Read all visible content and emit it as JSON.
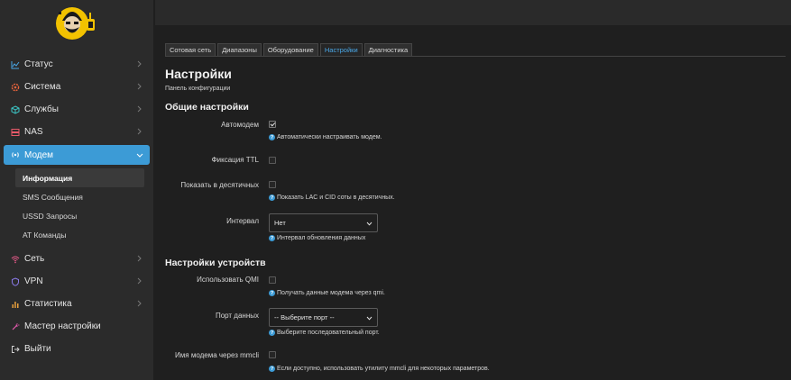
{
  "sidebar": {
    "items": [
      {
        "label": "Статус",
        "icon": "chart-line-icon"
      },
      {
        "label": "Система",
        "icon": "gear-icon"
      },
      {
        "label": "Службы",
        "icon": "cube-icon"
      },
      {
        "label": "NAS",
        "icon": "server-icon"
      },
      {
        "label": "Модем",
        "icon": "antenna-icon"
      },
      {
        "label": "Сеть",
        "icon": "wifi-icon"
      },
      {
        "label": "VPN",
        "icon": "shield-icon"
      },
      {
        "label": "Статистика",
        "icon": "bar-chart-icon"
      },
      {
        "label": "Мастер настройки",
        "icon": "magic-wand-icon"
      },
      {
        "label": "Выйти",
        "icon": "logout-icon"
      }
    ],
    "modem_sub": [
      "Информация",
      "SMS Сообщения",
      "USSD Запросы",
      "AT Команды"
    ]
  },
  "tabs": [
    "Сотовая сеть",
    "Диапазоны",
    "Оборудование",
    "Настройки",
    "Диагностика"
  ],
  "page": {
    "title": "Настройки",
    "subtitle": "Панель конфигурации"
  },
  "general": {
    "title": "Общие настройки",
    "automodem_label": "Автомодем",
    "automodem_hint": "Автоматически настраивать модем.",
    "ttl_label": "Фиксация TTL",
    "decimal_label": "Показать в десятичных",
    "decimal_hint": "Показать LAC и CID соты в десятичных.",
    "interval_label": "Интервал",
    "interval_value": "Нет",
    "interval_hint": "Интервал обновления данных"
  },
  "device": {
    "title": "Настройки устройств",
    "qmi_label": "Использовать QMI",
    "qmi_hint": "Получать данные модема через qmi.",
    "port_label": "Порт данных",
    "port_value": "-- Выберите порт --",
    "port_hint": "Выберите последовательный порт.",
    "mmcli_label": "Имя модема через mmcli",
    "mmcli_hint": "Если доступно, использовать утилиту mmcli для некоторых параметров."
  },
  "colors": {
    "accent": "#3c9bd6",
    "background": "#1f1f1f",
    "sidebar": "#2b2b2b"
  }
}
